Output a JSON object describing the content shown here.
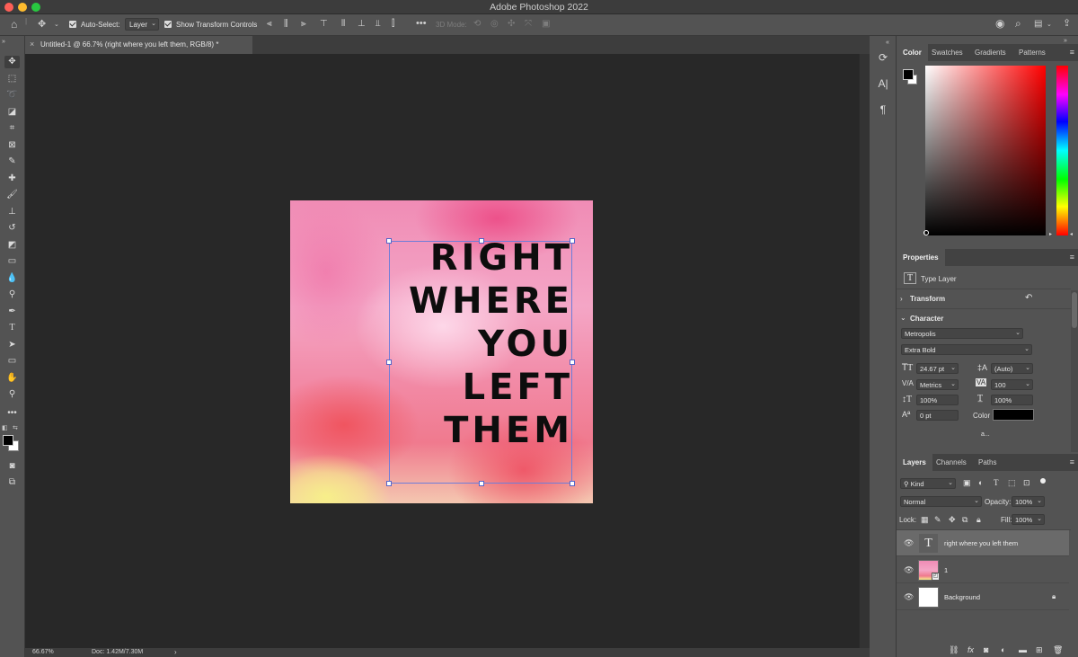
{
  "window": {
    "title": "Adobe Photoshop 2022",
    "traffic_colors": [
      "#fe5f57",
      "#febc2e",
      "#28c840"
    ]
  },
  "options_bar": {
    "auto_select_label": "Auto-Select:",
    "auto_select_checked": true,
    "auto_select_target": "Layer",
    "show_transform_label": "Show Transform Controls",
    "show_transform_checked": true,
    "mode_3d_label": "3D Mode:"
  },
  "document": {
    "tab_title": "Untitled-1 @ 66.7% (right where you left them, RGB/8) *",
    "zoom": "66.67%",
    "doc_info": "Doc: 1.42M/7.30M"
  },
  "artwork": {
    "lines": [
      "RIGHT",
      "WHERE",
      "YOU",
      "LEFT",
      "THEM"
    ]
  },
  "color_panel": {
    "tabs": [
      "Color",
      "Swatches",
      "Gradients",
      "Patterns"
    ],
    "active_tab": "Color",
    "foreground": "#000000",
    "background": "#ffffff"
  },
  "properties": {
    "tab": "Properties",
    "layer_type": "Type Layer",
    "transform_label": "Transform",
    "character_label": "Character",
    "font_family": "Metropolis",
    "font_style": "Extra Bold",
    "font_size": "24.67 pt",
    "leading": "(Auto)",
    "kerning": "Metrics",
    "tracking": "100",
    "vertical_scale": "100%",
    "horizontal_scale": "100%",
    "baseline_shift": "0 pt",
    "color_label": "Color",
    "text_color": "#000000",
    "more": "a..."
  },
  "layers_panel": {
    "tabs": [
      "Layers",
      "Channels",
      "Paths"
    ],
    "active_tab": "Layers",
    "filter": "Kind",
    "blend_mode": "Normal",
    "opacity_label": "Opacity:",
    "opacity": "100%",
    "lock_label": "Lock:",
    "fill_label": "Fill:",
    "fill": "100%",
    "layers": [
      {
        "name": "right where you left them",
        "type": "text",
        "selected": true
      },
      {
        "name": "1",
        "type": "image",
        "selected": false
      },
      {
        "name": "Background",
        "type": "background",
        "selected": false,
        "locked": true
      }
    ]
  }
}
